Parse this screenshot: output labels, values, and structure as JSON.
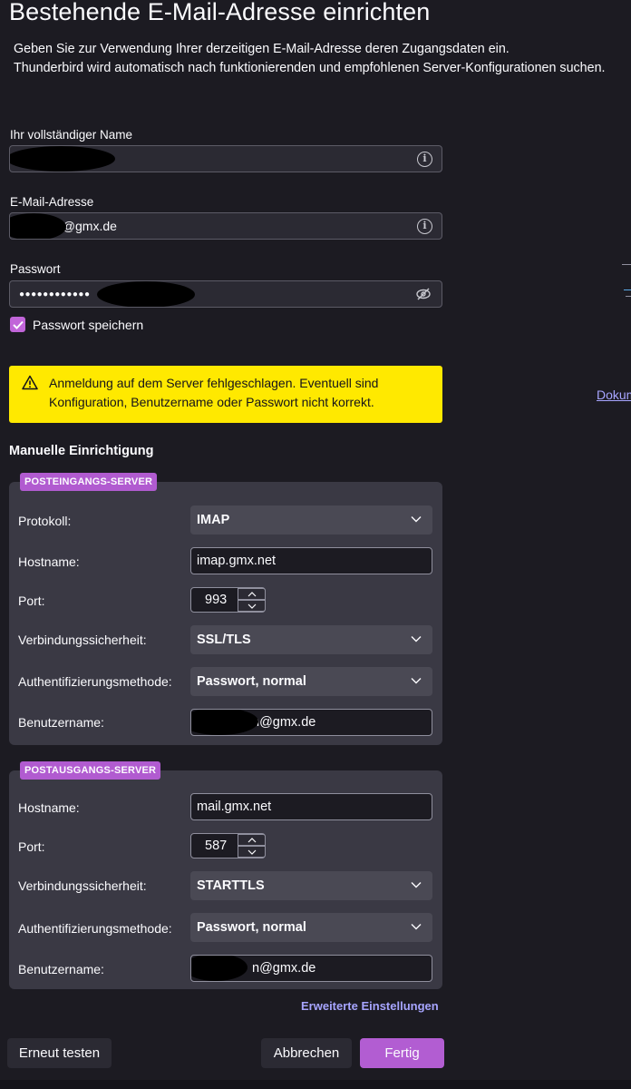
{
  "header": {
    "title": "Bestehende E-Mail-Adresse einrichten",
    "subtitle_line1": "Geben Sie zur Verwendung Ihrer derzeitigen E-Mail-Adresse deren Zugangsdaten ein.",
    "subtitle_line2": "Thunderbird wird automatisch nach funktionierenden und empfohlenen Server-Konfigurationen suchen."
  },
  "form": {
    "name_label": "Ihr vollständiger Name",
    "name_value": "",
    "email_label": "E-Mail-Adresse",
    "email_value": "n@gmx.de",
    "password_label": "Passwort",
    "password_value": "●●●●●●●●●●●●",
    "remember_password_label": "Passwort speichern",
    "remember_password_checked": true
  },
  "warning": {
    "line1": "Anmeldung auf dem Server fehlgeschlagen. Eventuell sind",
    "line2": "Konfiguration, Benutzername oder Passwort nicht korrekt."
  },
  "side_link": "Dokum",
  "manual": {
    "title": "Manuelle Einrichtigung",
    "incoming": {
      "badge": "POSTEINGANGS-SERVER",
      "protocol_label": "Protokoll:",
      "protocol_value": "IMAP",
      "hostname_label": "Hostname:",
      "hostname_value": "imap.gmx.net",
      "port_label": "Port:",
      "port_value": "993",
      "security_label": "Verbindungssicherheit:",
      "security_value": "SSL/TLS",
      "auth_label": "Authentifizierungsmethode:",
      "auth_value": "Passwort, normal",
      "username_label": "Benutzername:",
      "username_value": "n@gmx.de"
    },
    "outgoing": {
      "badge": "POSTAUSGANGS-SERVER",
      "hostname_label": "Hostname:",
      "hostname_value": "mail.gmx.net",
      "port_label": "Port:",
      "port_value": "587",
      "security_label": "Verbindungssicherheit:",
      "security_value": "STARTTLS",
      "auth_label": "Authentifizierungsmethode:",
      "auth_value": "Passwort, normal",
      "username_label": "Benutzername:",
      "username_value": "n@gmx.de"
    },
    "advanced_link": "Erweiterte Einstellungen"
  },
  "buttons": {
    "retest": "Erneut testen",
    "cancel": "Abbrechen",
    "done": "Fertig"
  },
  "colors": {
    "background": "#1c1b22",
    "accent": "#b25dd2",
    "warning": "#ffe900",
    "link": "#a7a5ff"
  }
}
